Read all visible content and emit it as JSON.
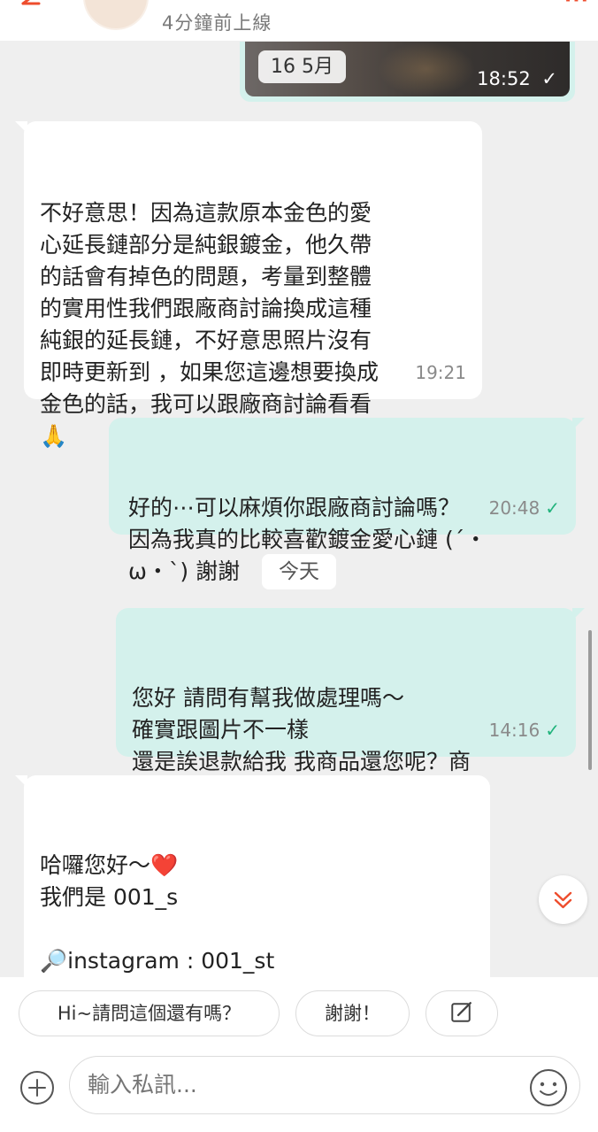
{
  "header": {
    "status": "4分鐘前上線",
    "menu_label": "···"
  },
  "image_message": {
    "date_label": "16 5月",
    "time": "18:52",
    "check": "✓"
  },
  "messages": [
    {
      "direction": "incoming",
      "text": "不好意思！因為這款原本金色的愛\n心延長鏈部分是純銀鍍金，他久帶\n的話會有掉色的問題，考量到整體\n的實用性我們跟廠商討論換成這種\n純銀的延長鏈，不好意思照片沒有\n即時更新到 ，如果您這邊想要換成\n金色的話，我可以跟廠商討論看看\n🙏",
      "time": "19:21"
    },
    {
      "direction": "outgoing",
      "text": "好的⋯可以麻煩你跟廠商討論嗎？\n因為我真的比較喜歡鍍金愛心鏈 (´・\nω・`) 謝謝",
      "time": "20:48",
      "check": "✓"
    },
    {
      "direction": "outgoing",
      "text": "您好 請問有幫我做處理嗎～\n確實跟圖片不一樣\n還是誒退款給我 我商品還您呢？商\n品全新未拆。",
      "time": "14:16",
      "check": "✓"
    },
    {
      "direction": "incoming",
      "text": "哈囉您好～❤️\n我們是 001_s\n\n🔎instagram : 001_st"
    }
  ],
  "day_separator": "今天",
  "quick_replies": [
    "Hi~請問這個還有嗎？",
    "謝謝！"
  ],
  "input": {
    "placeholder": "輸入私訊..."
  },
  "colors": {
    "accent": "#ee4d2d",
    "bubble_out": "#d4f1ec",
    "bubble_in": "#ffffff",
    "check": "#21b37c"
  },
  "icons": [
    "back-arrow-icon",
    "plus-icon",
    "emoji-icon",
    "edit-icon",
    "chevron-down-icon"
  ]
}
